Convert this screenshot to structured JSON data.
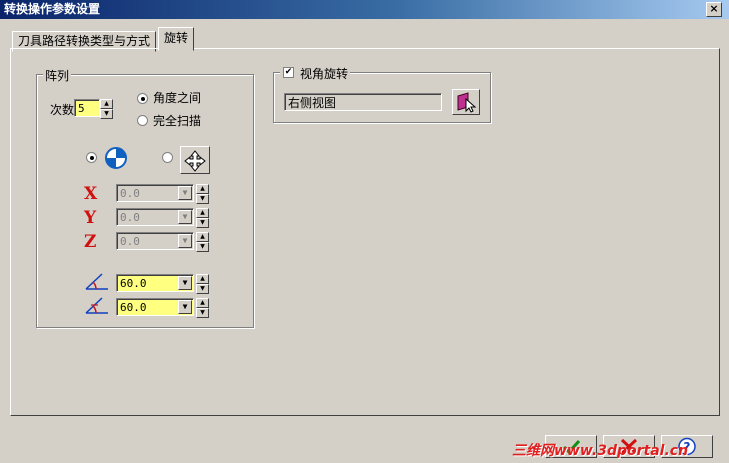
{
  "window": {
    "title": "转换操作参数设置",
    "close": "×"
  },
  "tabs": [
    {
      "label": "刀具路径转换类型与方式"
    },
    {
      "label": "旋转"
    }
  ],
  "array_group": {
    "label": "阵列",
    "count_label": "次数",
    "count_value": "5",
    "angle_between": "角度之间",
    "full_scan": "完全扫描"
  },
  "xyz": {
    "x_label": "X",
    "y_label": "Y",
    "z_label": "Z",
    "x_value": "0.0",
    "y_value": "0.0",
    "z_value": "0.0"
  },
  "angles": {
    "angle1": "60.0",
    "angle2": "60.0"
  },
  "view_group": {
    "label": "视角旋转",
    "value": "右侧视图",
    "checked": true
  },
  "watermark": "三维网www.3dportal.cn"
}
